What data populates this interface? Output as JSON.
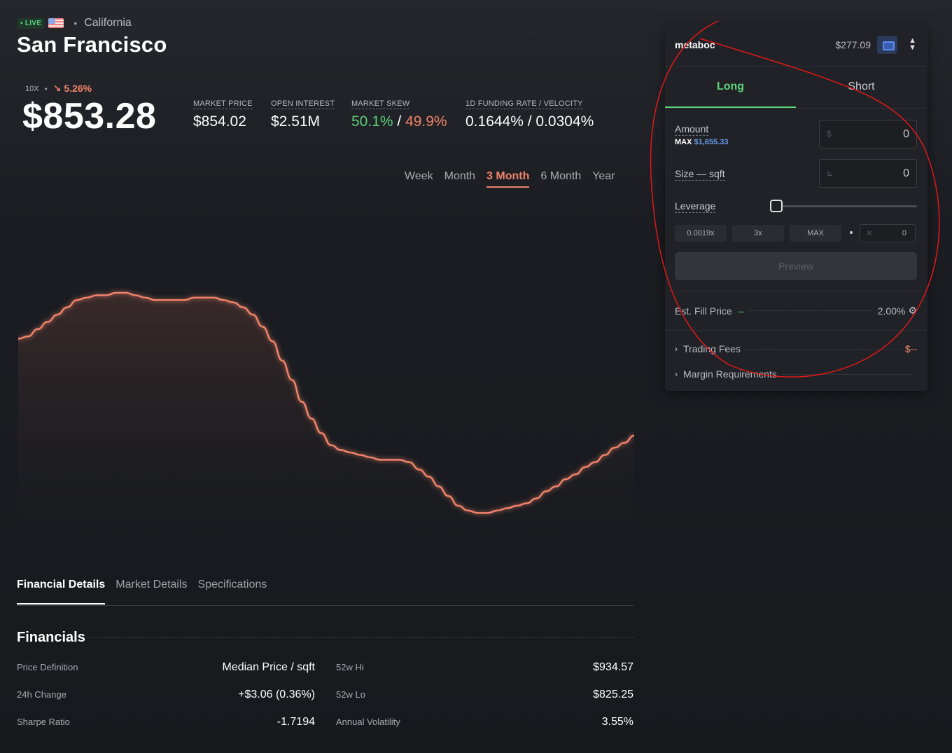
{
  "header": {
    "live_badge": "• LIVE",
    "region_sep": "•",
    "region": "California",
    "city": "San Francisco"
  },
  "price": {
    "leverage": "10X",
    "sep": "•",
    "change": "↘ 5.26%",
    "index_price": "$853.28"
  },
  "stats": [
    {
      "label": "MARKET PRICE",
      "value": "$854.02"
    },
    {
      "label": "OPEN INTEREST",
      "value": "$2.51M"
    },
    {
      "label": "MARKET SKEW",
      "long": "50.1%",
      "slash": " / ",
      "short": "49.9%"
    },
    {
      "label": "1D FUNDING RATE / VELOCITY",
      "value": "0.1644% / 0.0304%"
    }
  ],
  "periods": [
    "Week",
    "Month",
    "3 Month",
    "6 Month",
    "Year"
  ],
  "active_period": "3 Month",
  "chart_data": {
    "type": "area",
    "x": [
      0,
      1,
      2,
      3,
      4,
      5,
      6,
      7,
      8,
      9,
      10,
      11,
      12,
      13,
      14,
      15,
      16,
      17,
      18,
      19,
      20,
      21,
      22,
      23,
      24,
      25,
      26,
      27,
      28,
      29,
      30,
      31,
      32,
      33,
      34,
      35,
      36,
      37,
      38,
      39,
      40,
      41,
      42,
      43,
      44,
      45,
      46,
      47,
      48,
      49,
      50,
      51,
      52,
      53,
      54,
      55,
      56,
      57,
      58,
      59,
      60,
      61,
      62,
      63,
      64,
      65,
      66,
      67,
      68,
      69,
      70
    ],
    "values": [
      100,
      101,
      104,
      107,
      110,
      113,
      116,
      117,
      118,
      118,
      119,
      119,
      118,
      117,
      116,
      116,
      116,
      116,
      117,
      117,
      117,
      116,
      115,
      113,
      110,
      105,
      99,
      91,
      83,
      74,
      67,
      61,
      56,
      54,
      53,
      52,
      51,
      50,
      50,
      50,
      49,
      46,
      43,
      39,
      35,
      31,
      29,
      28,
      28,
      29,
      30,
      31,
      32,
      34,
      37,
      39,
      42,
      44,
      47,
      49,
      52,
      55,
      57,
      60
    ],
    "color": "#f0836a",
    "fill": "#3a2a2a",
    "grid": false
  },
  "detail_tabs": [
    "Financial Details",
    "Market Details",
    "Specifications"
  ],
  "financials": {
    "title": "Financials",
    "left": [
      {
        "label": "Price Definition",
        "value": "Median Price / sqft"
      },
      {
        "label": "24h Change",
        "value": "+$3.06 (0.36%)"
      },
      {
        "label": "Sharpe Ratio",
        "value": "-1.7194"
      }
    ],
    "right": [
      {
        "label": "52w Hi",
        "value": "$934.57"
      },
      {
        "label": "52w Lo",
        "value": "$825.25"
      },
      {
        "label": "Annual Volatility",
        "value": "3.55%"
      }
    ]
  },
  "panel": {
    "account": "metaboc",
    "balance": "$277.09",
    "tabs": [
      "Long",
      "Short"
    ],
    "amount_label": "Amount",
    "max_prefix": "MAX",
    "max_value": "$1,655.33",
    "amount_prefix": "$",
    "amount_value": "0",
    "size_label": "Size — sqft",
    "size_prefix": "⊾",
    "size_value": "0",
    "leverage_label": "Leverage",
    "leverage_level": 0,
    "lev_buttons": [
      "0.0019x",
      "3x",
      "MAX"
    ],
    "lev_prefix": "✕",
    "lev_value": "0",
    "preview": "Preview",
    "fill_label": "Est. Fill Price",
    "fill_value": "--",
    "slippage": "2.00%",
    "fees_label": "Trading Fees",
    "fees_value": "$--",
    "margin_label": "Margin Requirements"
  }
}
